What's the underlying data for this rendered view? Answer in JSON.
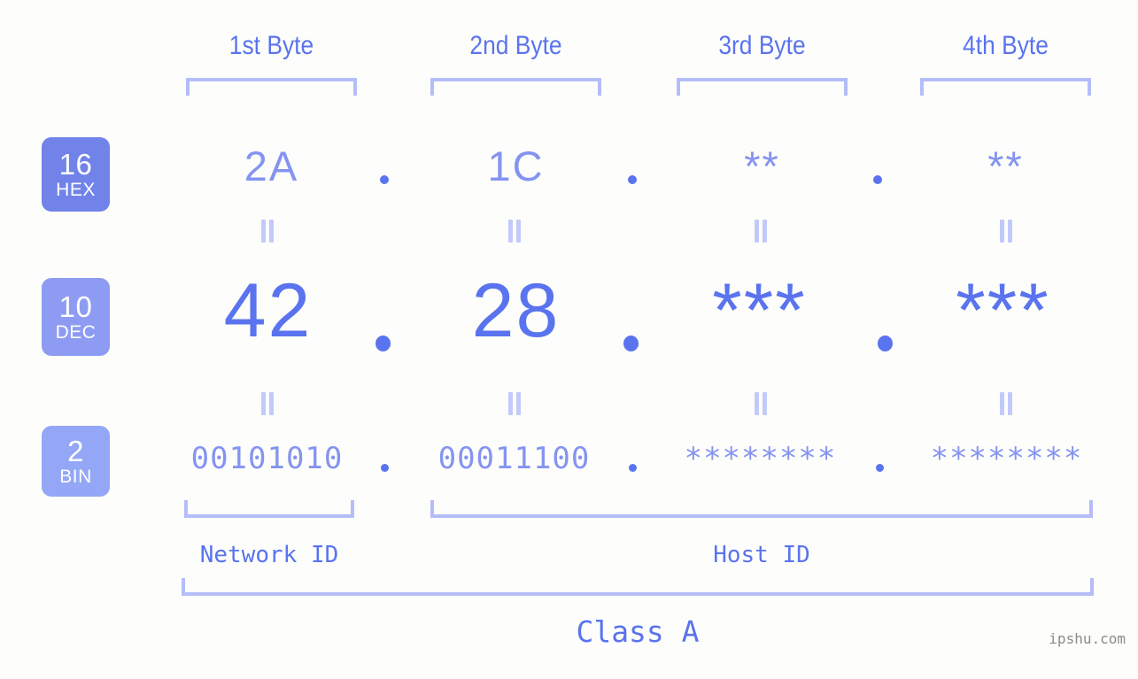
{
  "background_color": "#fdfefb",
  "accent_color": "#5a73ef",
  "accent_light_color": "#8593f1",
  "bracket_color": "#b4bdf9",
  "headers": {
    "byte1": "1st Byte",
    "byte2": "2nd Byte",
    "byte3": "3rd Byte",
    "byte4": "4th Byte"
  },
  "bases": [
    {
      "number": "16",
      "name": "HEX",
      "color": "#7183e9"
    },
    {
      "number": "10",
      "name": "DEC",
      "color": "#8e9bf2"
    },
    {
      "number": "2",
      "name": "BIN",
      "color": "#94a7f6"
    }
  ],
  "rows": {
    "hex": {
      "base_number": "16",
      "base_name": "HEX",
      "values": [
        "2A",
        "1C",
        "**",
        "**"
      ],
      "separator": "."
    },
    "dec": {
      "base_number": "10",
      "base_name": "DEC",
      "values": [
        "42",
        "28",
        "***",
        "***"
      ],
      "separator": "."
    },
    "bin": {
      "base_number": "2",
      "base_name": "BIN",
      "values": [
        "00101010",
        "00011100",
        "********",
        "********"
      ],
      "separator": "."
    }
  },
  "equality_symbol": "=",
  "segments": {
    "network_id": "Network ID",
    "host_id": "Host ID"
  },
  "class_label": "Class A",
  "watermark": "ipshu.com"
}
